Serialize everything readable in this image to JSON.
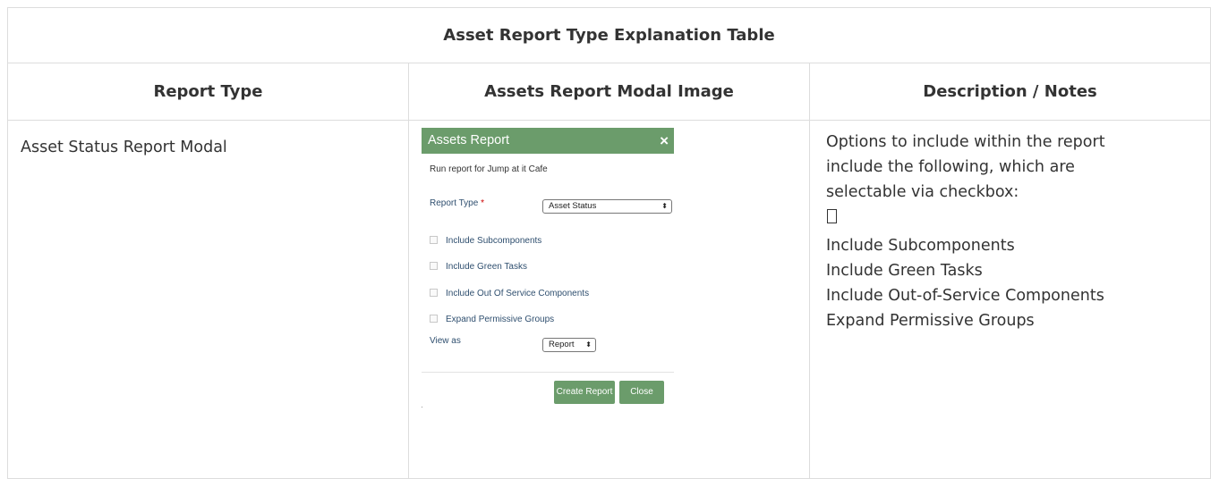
{
  "table": {
    "caption": "Asset Report Type Explanation Table",
    "headers": [
      "Report Type",
      "Assets Report Modal Image",
      "Description / Notes"
    ],
    "rows": [
      {
        "report_type": "Asset Status Report Modal",
        "notes": {
          "intro_lines": [
            "Options to include within the report",
            "include the following, which are",
            "selectable via checkbox:"
          ],
          "items": [
            "Include Subcomponents",
            "Include Green Tasks",
            "Include Out-of-Service Components",
            "Expand Permissive Groups"
          ]
        }
      }
    ]
  },
  "modal": {
    "title": "Assets Report",
    "close_icon": "×",
    "subtitle": "Run report for Jump at it Cafe",
    "report_type_label": "Report Type",
    "required_mark": "*",
    "report_type_value": "Asset Status",
    "select_arrow": "⬍",
    "checkboxes": [
      "Include Subcomponents",
      "Include Green Tasks",
      "Include Out Of Service Components",
      "Expand Permissive Groups"
    ],
    "view_as_label": "View as",
    "view_as_value": "Report",
    "create_button": "Create Report",
    "close_button": "Close"
  },
  "colors": {
    "modal_green": "#6b9c6b",
    "border": "#dddddd",
    "text": "#333333"
  }
}
